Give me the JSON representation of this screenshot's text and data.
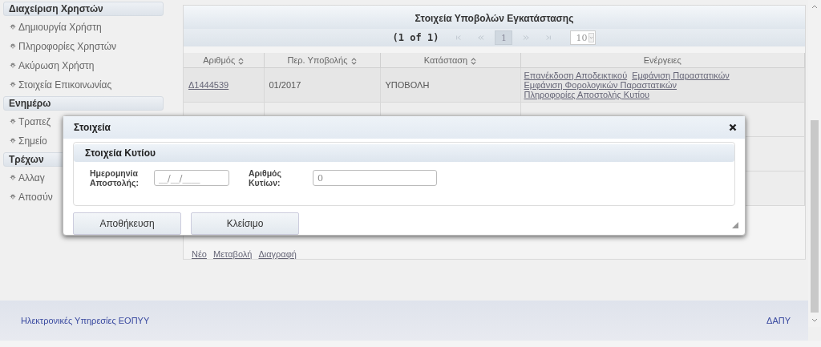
{
  "sidebar": {
    "sections": [
      {
        "title": "Διαχείριση Χρηστών",
        "items": [
          "Δημιουργία Χρήστη",
          "Πληροφορίες Χρηστών",
          "Ακύρωση Χρήστη",
          "Στοιχεία Επικοινωνίας"
        ]
      },
      {
        "title": "Ενημέρω",
        "items": [
          "Τραπεζ",
          "Σημείο"
        ]
      },
      {
        "title": "Τρέχων",
        "items": [
          "Αλλαγ",
          "Αποσύν"
        ]
      }
    ]
  },
  "table": {
    "title": "Στοιχεία Υποβολών Εγκατάστασης",
    "paginator": {
      "summary": "(1 of 1)",
      "nav_before": [
        {
          "kind": "first",
          "disabled": true
        },
        {
          "kind": "prev",
          "disabled": true
        }
      ],
      "pages": [
        {
          "label": "1",
          "selected": true
        }
      ],
      "nav_after": [
        {
          "kind": "next",
          "disabled": true
        },
        {
          "kind": "last",
          "disabled": true
        }
      ],
      "rows_per_page": "10"
    },
    "columns": [
      {
        "label": "Αριθμός",
        "sortable": true
      },
      {
        "label": "Περ. Υποβολής",
        "sortable": true
      },
      {
        "label": "Κατάσταση",
        "sortable": true
      },
      {
        "label": "Ενέργειες",
        "sortable": false
      }
    ],
    "rows": [
      {
        "number": "Δ1444539",
        "period": "01/2017",
        "status": "ΥΠΟΒΟΛΗ",
        "actions": [
          "Επανέκδοση Αποδεικτικού",
          "Εμφάνιση Παραστατικών",
          "Εμφάνιση Φορολογικών Παραστατικών",
          "Πληροφορίες Αποστολής Κυτίου"
        ]
      }
    ]
  },
  "links": [
    "Νέο",
    "Μεταβολή",
    "Διαγραφή"
  ],
  "dialog": {
    "title": "Στοιχεία",
    "section": "Στοιχεία Κυτίου",
    "fields": [
      {
        "label": "Ημερομηνία Αποστολής:",
        "value": "__/__/____"
      },
      {
        "label": "Αριθμός Κυτίων:",
        "value": "0"
      }
    ],
    "buttons": [
      "Αποθήκευση",
      "Κλείσιμο"
    ]
  },
  "footer": {
    "left": "Ηλεκτρονικές Υπηρεσίες ΕΟΠΥΥ",
    "right": "ΔΑΠΥ"
  }
}
